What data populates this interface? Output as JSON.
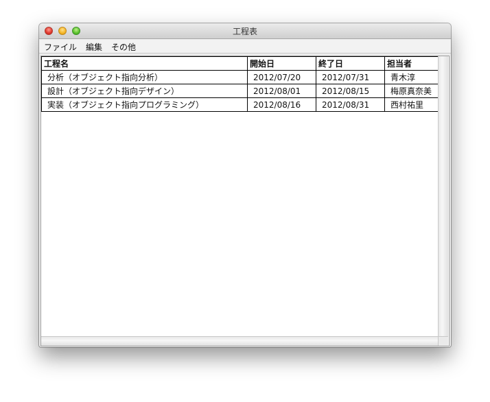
{
  "window": {
    "title": "工程表",
    "controls": {
      "close": "close-icon",
      "minimize": "minimize-icon",
      "zoom": "zoom-icon"
    }
  },
  "menubar": {
    "items": [
      {
        "label": "ファイル"
      },
      {
        "label": "編集"
      },
      {
        "label": "その他"
      }
    ]
  },
  "table": {
    "columns": [
      "工程名",
      "開始日",
      "終了日",
      "担当者"
    ],
    "rows": [
      {
        "name": "分析（オブジェクト指向分析）",
        "start": "2012/07/20",
        "end": "2012/07/31",
        "owner": "青木淳"
      },
      {
        "name": "設計（オブジェクト指向デザイン）",
        "start": "2012/08/01",
        "end": "2012/08/15",
        "owner": "梅原真奈美"
      },
      {
        "name": "実装（オブジェクト指向プログラミング）",
        "start": "2012/08/16",
        "end": "2012/08/31",
        "owner": "西村祐里"
      }
    ]
  },
  "colors": {
    "close": "#e0362b",
    "minimize": "#f4b423",
    "zoom": "#59c12b",
    "grid_border": "#000000"
  }
}
